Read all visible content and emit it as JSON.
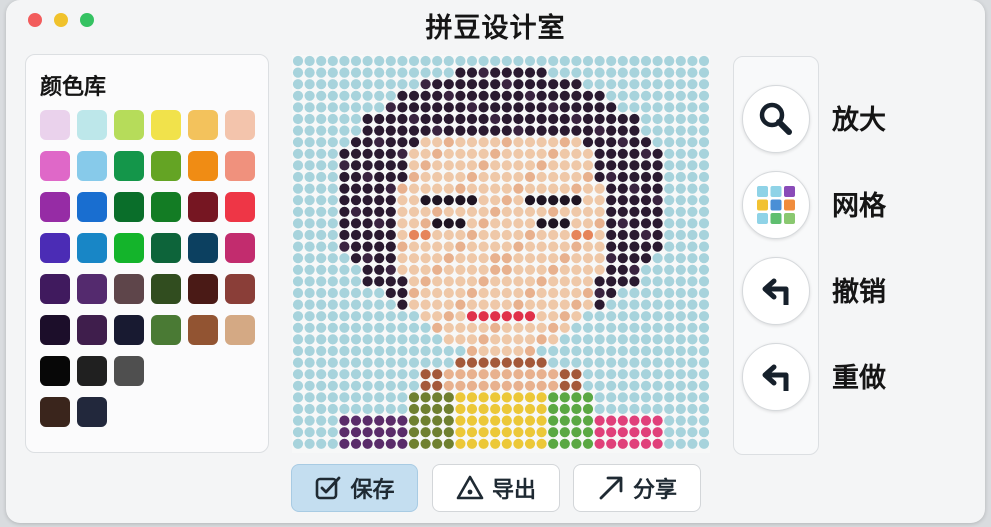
{
  "window": {
    "title": "拼豆设计室",
    "traffic_lights": [
      "#f25c5c",
      "#f0c22c",
      "#35c262"
    ]
  },
  "palette": {
    "title": "颜色库",
    "rows": [
      [
        "#ead2ec",
        "#bde7ea",
        "#b6dc5a",
        "#f1e24b",
        "#f3c25c",
        "#f3c4ac"
      ],
      [
        "#df68c8",
        "#87caea",
        "#14964a",
        "#64a424",
        "#f08c14",
        "#f0917d"
      ],
      [
        "#962ca5",
        "#196ed0",
        "#0a6e2a",
        "#137c24",
        "#761622",
        "#ee3646"
      ],
      [
        "#4b2cb5",
        "#1886c6",
        "#14b42b",
        "#0d643a",
        "#0c4060",
        "#c22c6e"
      ],
      [
        "#401a5e",
        "#542a6e",
        "#5e454a",
        "#314d1f",
        "#4a1a16",
        "#8a3e38"
      ],
      [
        "#1c0e2a",
        "#3f1e4c",
        "#181a31",
        "#4a7a34",
        "#925432",
        "#d4a984"
      ],
      [
        "#070707",
        "#202020",
        "#4f4f4f"
      ],
      [
        "#3a251c",
        "#22283c"
      ]
    ]
  },
  "canvas": {
    "label": "pixel-portrait"
  },
  "tools": [
    {
      "id": "zoom",
      "label": "放大",
      "icon": "magnifier-icon"
    },
    {
      "id": "grid",
      "label": "网格",
      "icon": "grid-icon"
    },
    {
      "id": "undo",
      "label": "撤销",
      "icon": "undo-arrow-icon"
    },
    {
      "id": "redo",
      "label": "重做",
      "icon": "redo-arrow-icon"
    }
  ],
  "actions": {
    "save": {
      "label": "保存",
      "icon": "checkbox-icon"
    },
    "export": {
      "label": "导出",
      "icon": "warning-triangle-icon"
    },
    "share": {
      "label": "分享",
      "icon": "diagonal-arrow-icon"
    }
  }
}
